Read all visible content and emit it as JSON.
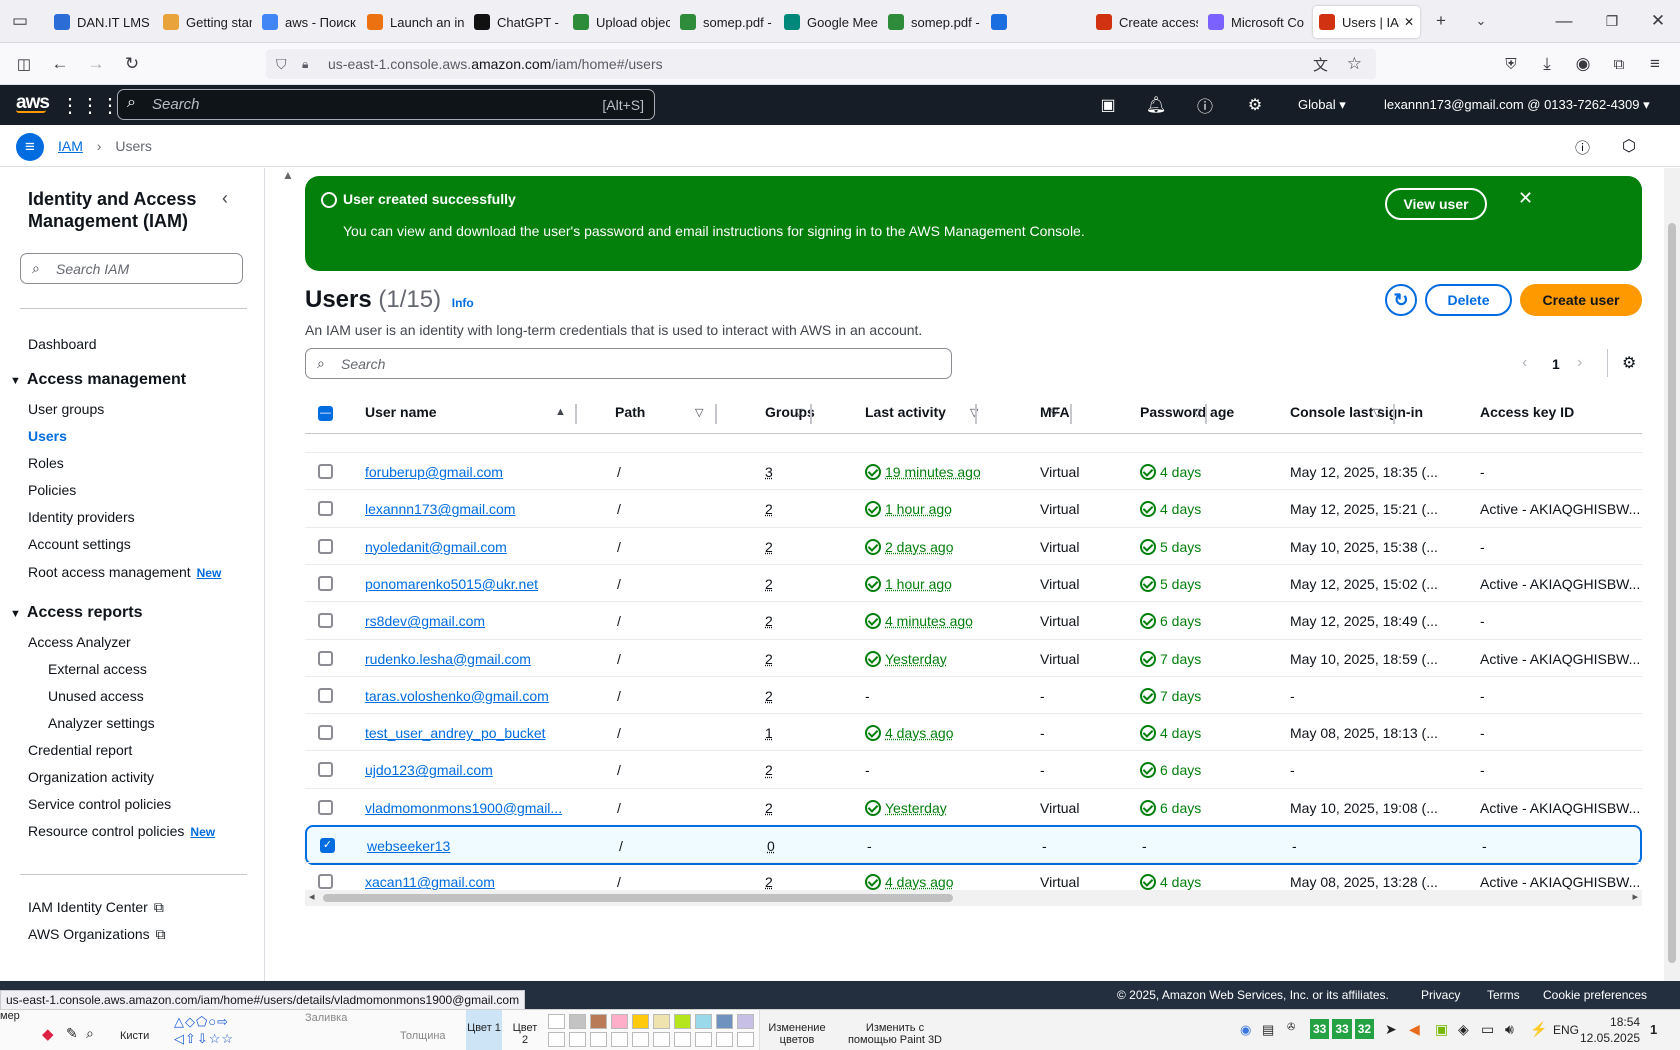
{
  "browser": {
    "tabs": [
      {
        "label": "DAN.IT LMS",
        "color": "#2b6cd6"
      },
      {
        "label": "Getting starte",
        "color": "#e8a33a"
      },
      {
        "label": "aws - Поиск",
        "color": "#4285f4"
      },
      {
        "label": "Launch an ins",
        "color": "#ec7211"
      },
      {
        "label": "ChatGPT - ча",
        "color": "#111111"
      },
      {
        "label": "Upload objec",
        "color": "#2e8b3a"
      },
      {
        "label": "somep.pdf - ",
        "color": "#2e8b3a"
      },
      {
        "label": "Google Meet",
        "color": "#00897b"
      },
      {
        "label": "somep.pdf - ",
        "color": "#2e8b3a"
      },
      {
        "label": "",
        "color": "#1a6ee0"
      },
      {
        "label": "Create access",
        "color": "#d13212"
      },
      {
        "label": "Microsoft Co",
        "color": "#7b61ff"
      },
      {
        "label": "Users | IAM",
        "color": "#d13212"
      }
    ],
    "url_prefix": "us-east-1.console.aws.",
    "url_domain": "amazon.com",
    "url_suffix": "/iam/home#/users",
    "status_url": "us-east-1.console.aws.amazon.com/iam/home#/users/details/vladmomonmons1900@gmail.com"
  },
  "aws_header": {
    "search_placeholder": "Search",
    "search_shortcut": "[Alt+S]",
    "region": "Global",
    "account": "lexannn173@gmail.com @ 0133-7262-4309"
  },
  "breadcrumb": {
    "service": "IAM",
    "page": "Users"
  },
  "sidebar": {
    "title": "Identity and Access Management (IAM)",
    "search_placeholder": "Search IAM",
    "dashboard": "Dashboard",
    "access_management": "Access management",
    "am_items": [
      "User groups",
      "Users",
      "Roles",
      "Policies",
      "Identity providers",
      "Account settings",
      "Root access management"
    ],
    "new_tag": "New",
    "access_reports": "Access reports",
    "access_analyzer": "Access Analyzer",
    "analyzer_items": [
      "External access",
      "Unused access",
      "Analyzer settings"
    ],
    "ar_items": [
      "Credential report",
      "Organization activity",
      "Service control policies",
      "Resource control policies"
    ],
    "bottom_links": [
      "IAM Identity Center",
      "AWS Organizations"
    ]
  },
  "flash": {
    "title": "User created successfully",
    "message": "You can view and download the user's password and email instructions for signing in to the AWS Management Console.",
    "view_button": "View user"
  },
  "users": {
    "title": "Users",
    "count": "(1/15)",
    "info": "Info",
    "description": "An IAM user is an identity with long-term credentials that is used to interact with AWS in an account.",
    "delete_button": "Delete",
    "create_button": "Create user",
    "search_placeholder": "Search",
    "page": "1",
    "columns": [
      "User name",
      "Path",
      "Groups",
      "Last activity",
      "MFA",
      "Password age",
      "Console last sign-in",
      "Access key ID"
    ],
    "rows": [
      {
        "name": "foruberup@gmail.com",
        "path": "/",
        "groups": "3",
        "activity": "19 minutes ago",
        "mfa": "Virtual",
        "pwage": "4 days",
        "signin": "May 12, 2025, 18:35 (...",
        "key": "-",
        "selected": false
      },
      {
        "name": "lexannn173@gmail.com",
        "path": "/",
        "groups": "2",
        "activity": "1 hour ago",
        "mfa": "Virtual",
        "pwage": "4 days",
        "signin": "May 12, 2025, 15:21 (...",
        "key": "Active - AKIAQGHISBW...",
        "selected": false
      },
      {
        "name": "nyoledanit@gmail.com",
        "path": "/",
        "groups": "2",
        "activity": "2 days ago",
        "mfa": "Virtual",
        "pwage": "5 days",
        "signin": "May 10, 2025, 15:38 (...",
        "key": "-",
        "selected": false
      },
      {
        "name": "ponomarenko5015@ukr.net",
        "path": "/",
        "groups": "2",
        "activity": "1 hour ago",
        "mfa": "Virtual",
        "pwage": "5 days",
        "signin": "May 12, 2025, 15:02 (...",
        "key": "Active - AKIAQGHISBW...",
        "selected": false
      },
      {
        "name": "rs8dev@gmail.com",
        "path": "/",
        "groups": "2",
        "activity": "4 minutes ago",
        "mfa": "Virtual",
        "pwage": "6 days",
        "signin": "May 12, 2025, 18:49 (...",
        "key": "-",
        "selected": false
      },
      {
        "name": "rudenko.lesha@gmail.com",
        "path": "/",
        "groups": "2",
        "activity": "Yesterday",
        "mfa": "Virtual",
        "pwage": "7 days",
        "signin": "May 10, 2025, 18:59 (...",
        "key": "Active - AKIAQGHISBW...",
        "selected": false
      },
      {
        "name": "taras.voloshenko@gmail.com",
        "path": "/",
        "groups": "2",
        "activity": "-",
        "mfa": "-",
        "pwage": "7 days",
        "signin": "-",
        "key": "-",
        "selected": false
      },
      {
        "name": "test_user_andrey_po_bucket",
        "path": "/",
        "groups": "1",
        "activity": "4 days ago",
        "mfa": "-",
        "pwage": "4 days",
        "signin": "May 08, 2025, 18:13 (...",
        "key": "-",
        "selected": false
      },
      {
        "name": "ujdo123@gmail.com",
        "path": "/",
        "groups": "2",
        "activity": "-",
        "mfa": "-",
        "pwage": "6 days",
        "signin": "-",
        "key": "-",
        "selected": false
      },
      {
        "name": "vladmomonmons1900@gmail...",
        "path": "/",
        "groups": "2",
        "activity": "Yesterday",
        "mfa": "Virtual",
        "pwage": "6 days",
        "signin": "May 10, 2025, 19:08 (...",
        "key": "Active - AKIAQGHISBW...",
        "selected": false
      },
      {
        "name": "webseeker13",
        "path": "/",
        "groups": "0",
        "activity": "-",
        "mfa": "-",
        "pwage": "-",
        "signin": "-",
        "key": "-",
        "selected": true
      },
      {
        "name": "xacan11@gmail.com",
        "path": "/",
        "groups": "2",
        "activity": "4 days ago",
        "mfa": "Virtual",
        "pwage": "4 days",
        "signin": "May 08, 2025, 13:28 (...",
        "key": "Active - AKIAQGHISBW...",
        "selected": false
      }
    ]
  },
  "footer": {
    "copyright": "© 2025, Amazon Web Services, Inc. or its affiliates.",
    "links": [
      "Privacy",
      "Terms",
      "Cookie preferences"
    ]
  },
  "taskbar": {
    "paint_labels": [
      "мер",
      "Кисти",
      "Заливка",
      "Толщина",
      "Цвет 1",
      "Цвет 2",
      "Изменение цветов",
      "Изменить с помощью Paint 3D"
    ],
    "tray_numbers": [
      "33",
      "33",
      "32"
    ],
    "lang": "ENG",
    "time": "18:54",
    "date": "12.05.2025",
    "notif": "1"
  },
  "colors": {
    "aws_dark": "#161d26",
    "link": "#006ce0",
    "success": "#037f0c",
    "primary_btn": "#ff9900"
  }
}
